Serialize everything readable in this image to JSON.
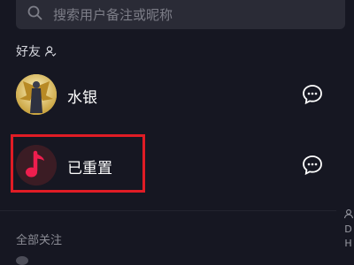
{
  "search": {
    "placeholder": "搜索用户备注或昵称"
  },
  "sections": {
    "friends_title": "好友",
    "all_following_title": "全部关注"
  },
  "friends": [
    {
      "name": "水银",
      "avatar_icon": "golden-winged-figure-avatar"
    },
    {
      "name": "已重置",
      "avatar_icon": "music-note-avatar"
    }
  ],
  "edge_letters": [
    "D",
    "H"
  ],
  "colors": {
    "background": "#161722",
    "search_bg": "#2a2b36",
    "highlight": "#e01c25",
    "music_note": "#ee1e4e"
  }
}
